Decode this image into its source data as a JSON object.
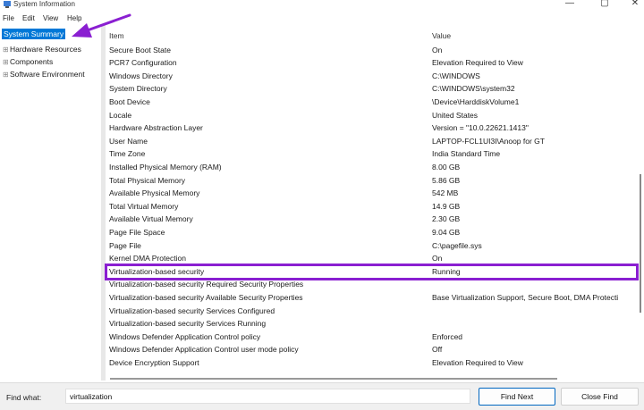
{
  "window": {
    "title": "System Information",
    "controls": [
      "—",
      "▢",
      "✕"
    ]
  },
  "menu": [
    "File",
    "Edit",
    "View",
    "Help"
  ],
  "tree": {
    "items": [
      {
        "label": "System Summary",
        "selected": true
      },
      {
        "label": "Hardware Resources",
        "expand": "⊞"
      },
      {
        "label": "Components",
        "expand": "⊞"
      },
      {
        "label": "Software Environment",
        "expand": "⊞"
      }
    ]
  },
  "table": {
    "headers": [
      "Item",
      "Value"
    ],
    "rows": [
      [
        "Secure Boot State",
        "On"
      ],
      [
        "PCR7 Configuration",
        "Elevation Required to View"
      ],
      [
        "Windows Directory",
        "C:\\WINDOWS"
      ],
      [
        "System Directory",
        "C:\\WINDOWS\\system32"
      ],
      [
        "Boot Device",
        "\\Device\\HarddiskVolume1"
      ],
      [
        "Locale",
        "United States"
      ],
      [
        "Hardware Abstraction Layer",
        "Version = \"10.0.22621.1413\""
      ],
      [
        "User Name",
        "LAPTOP-FCL1UI3I\\Anoop for GT"
      ],
      [
        "Time Zone",
        "India Standard Time"
      ],
      [
        "Installed Physical Memory (RAM)",
        "8.00 GB"
      ],
      [
        "Total Physical Memory",
        "5.86 GB"
      ],
      [
        "Available Physical Memory",
        "542 MB"
      ],
      [
        "Total Virtual Memory",
        "14.9 GB"
      ],
      [
        "Available Virtual Memory",
        "2.30 GB"
      ],
      [
        "Page File Space",
        "9.04 GB"
      ],
      [
        "Page File",
        "C:\\pagefile.sys"
      ],
      [
        "Kernel DMA Protection",
        "On"
      ],
      [
        "Virtualization-based security",
        "Running"
      ],
      [
        "Virtualization-based security Required Security Properties",
        ""
      ],
      [
        "Virtualization-based security Available Security Properties",
        "Base Virtualization Support, Secure Boot, DMA Protecti"
      ],
      [
        "Virtualization-based security Services Configured",
        ""
      ],
      [
        "Virtualization-based security Services Running",
        ""
      ],
      [
        "Windows Defender Application Control policy",
        "Enforced"
      ],
      [
        "Windows Defender Application Control user mode policy",
        "Off"
      ],
      [
        "Device Encryption Support",
        "Elevation Required to View"
      ]
    ]
  },
  "find": {
    "label": "Find what:",
    "value": "virtualization",
    "find_next": "Find Next",
    "close_find": "Close Find"
  },
  "annotation": {
    "color": "#8a1fd1"
  }
}
